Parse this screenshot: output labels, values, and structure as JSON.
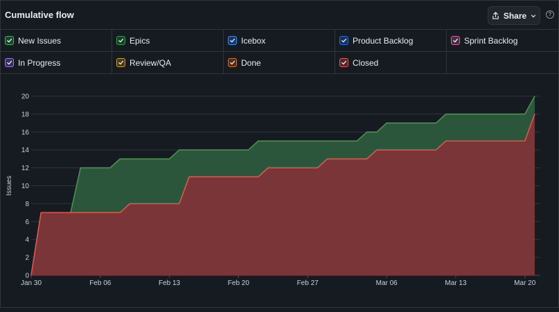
{
  "header": {
    "title": "Cumulative flow",
    "share_label": "Share",
    "share_icon": "upload-icon",
    "help_icon": "question-circle-icon"
  },
  "filters": [
    {
      "label": "New Issues",
      "color": "#3fb950",
      "checked": true
    },
    {
      "label": "Epics",
      "color": "#2ea043",
      "checked": true
    },
    {
      "label": "Icebox",
      "color": "#388bfd",
      "checked": true
    },
    {
      "label": "Product Backlog",
      "color": "#1f6feb",
      "checked": true
    },
    {
      "label": "Sprint Backlog",
      "color": "#db61a2",
      "checked": true
    },
    {
      "label": "In Progress",
      "color": "#a371f7",
      "checked": true
    },
    {
      "label": "Review/QA",
      "color": "#d29922",
      "checked": true
    },
    {
      "label": "Done",
      "color": "#db6d28",
      "checked": true
    },
    {
      "label": "Closed",
      "color": "#f85149",
      "checked": true
    }
  ],
  "chart_data": {
    "type": "area",
    "stacked": true,
    "ylabel": "Issues",
    "ylim": [
      0,
      20
    ],
    "yticks": [
      0,
      2,
      4,
      6,
      8,
      10,
      12,
      14,
      16,
      18,
      20
    ],
    "xlim": [
      "2024-01-30",
      "2024-03-21"
    ],
    "xticks": [
      {
        "date": "2024-01-30",
        "label": "Jan 30"
      },
      {
        "date": "2024-02-06",
        "label": "Feb 06"
      },
      {
        "date": "2024-02-13",
        "label": "Feb 13"
      },
      {
        "date": "2024-02-20",
        "label": "Feb 20"
      },
      {
        "date": "2024-02-27",
        "label": "Feb 27"
      },
      {
        "date": "2024-03-06",
        "label": "Mar 06"
      },
      {
        "date": "2024-03-13",
        "label": "Mar 13"
      },
      {
        "date": "2024-03-20",
        "label": "Mar 20"
      }
    ],
    "grid": true,
    "series": [
      {
        "name": "Closed",
        "color": "#e5534b",
        "fill": "#7d3438",
        "points": [
          [
            "2024-01-30",
            0
          ],
          [
            "2024-01-31",
            7
          ],
          [
            "2024-02-08",
            7
          ],
          [
            "2024-02-09",
            8
          ],
          [
            "2024-02-14",
            8
          ],
          [
            "2024-02-15",
            11
          ],
          [
            "2024-02-22",
            11
          ],
          [
            "2024-02-23",
            12
          ],
          [
            "2024-02-28",
            12
          ],
          [
            "2024-02-29",
            13
          ],
          [
            "2024-03-04",
            13
          ],
          [
            "2024-03-05",
            14
          ],
          [
            "2024-03-11",
            14
          ],
          [
            "2024-03-12",
            15
          ],
          [
            "2024-03-20",
            15
          ],
          [
            "2024-03-21",
            18
          ]
        ]
      },
      {
        "name": "Epics",
        "color": "#46954a",
        "fill": "#2d5a3d",
        "points": [
          [
            "2024-01-30",
            0
          ],
          [
            "2024-01-31",
            7
          ],
          [
            "2024-02-03",
            7
          ],
          [
            "2024-02-04",
            12
          ],
          [
            "2024-02-07",
            12
          ],
          [
            "2024-02-08",
            13
          ],
          [
            "2024-02-13",
            13
          ],
          [
            "2024-02-14",
            14
          ],
          [
            "2024-02-21",
            14
          ],
          [
            "2024-02-22",
            15
          ],
          [
            "2024-03-03",
            15
          ],
          [
            "2024-03-04",
            16
          ],
          [
            "2024-03-05",
            16
          ],
          [
            "2024-03-06",
            17
          ],
          [
            "2024-03-11",
            17
          ],
          [
            "2024-03-12",
            18
          ],
          [
            "2024-03-20",
            18
          ],
          [
            "2024-03-21",
            20
          ]
        ]
      }
    ]
  }
}
